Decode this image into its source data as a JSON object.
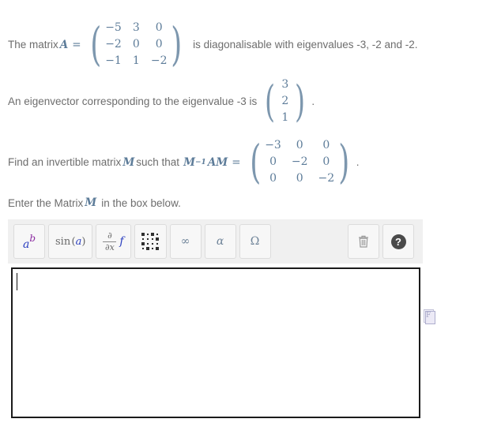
{
  "problem": {
    "line1": {
      "prefix": "The matrix",
      "var_a": "A",
      "equals": "=",
      "matrix_a": [
        [
          "−5",
          "3",
          "0"
        ],
        [
          "−2",
          "0",
          "0"
        ],
        [
          "−1",
          "1",
          "−2"
        ]
      ],
      "suffix": "is diagonalisable with eigenvalues -3, -2 and -2."
    },
    "line2": {
      "prefix": "An eigenvector corresponding to the eigenvalue -3 is",
      "vector": [
        "3",
        "2",
        "1"
      ],
      "period": "."
    },
    "line3": {
      "prefix": "Find an invertible matrix",
      "var_m": "M",
      "middle": "such that",
      "expr_m_inv": "M",
      "expr_sup": "−1",
      "expr_am": "AM",
      "equals": "=",
      "matrix_d": [
        [
          "−3",
          "0",
          "0"
        ],
        [
          "0",
          "−2",
          "0"
        ],
        [
          "0",
          "0",
          "−2"
        ]
      ],
      "period": "."
    },
    "prompt": {
      "before": "Enter the Matrix",
      "var_m": "M",
      "after": "in the box below."
    }
  },
  "toolbar": {
    "buttons": [
      {
        "name": "exponent-button",
        "icon": "a-superscript-b-icon",
        "label_base": "a",
        "label_sup": "b"
      },
      {
        "name": "trig-button",
        "icon": "sin-icon",
        "label_fn": "sin",
        "label_arg": "a"
      },
      {
        "name": "derivative-button",
        "icon": "partial-derivative-icon",
        "numerator": "∂",
        "denominator": "∂x",
        "fn": "f"
      },
      {
        "name": "matrix-button",
        "icon": "matrix-grid-icon"
      },
      {
        "name": "infinity-button",
        "icon": "infinity-icon",
        "label": "∞"
      },
      {
        "name": "greek-alpha-button",
        "icon": "alpha-icon",
        "label": "α"
      },
      {
        "name": "greek-omega-button",
        "icon": "omega-icon",
        "label": "Ω"
      }
    ],
    "delete_button": {
      "name": "delete-button",
      "icon": "trash-icon"
    },
    "help_button": {
      "name": "help-button",
      "icon": "help-circle-icon",
      "label": "?"
    }
  },
  "answer_input": {
    "name": "answer-input",
    "value": "",
    "placeholder": ""
  },
  "side_panel": {
    "doc_icon": {
      "name": "document-icon",
      "letter": "F"
    }
  },
  "colors": {
    "text": "#6d6d6d",
    "math": "#5d7c99",
    "toolbar_bg": "#f0f0f0",
    "button_bg": "#f7f7f7",
    "input_border": "#1b1b1b",
    "accent_blue": "#2b3fbf",
    "accent_purple": "#8b2ba0"
  }
}
